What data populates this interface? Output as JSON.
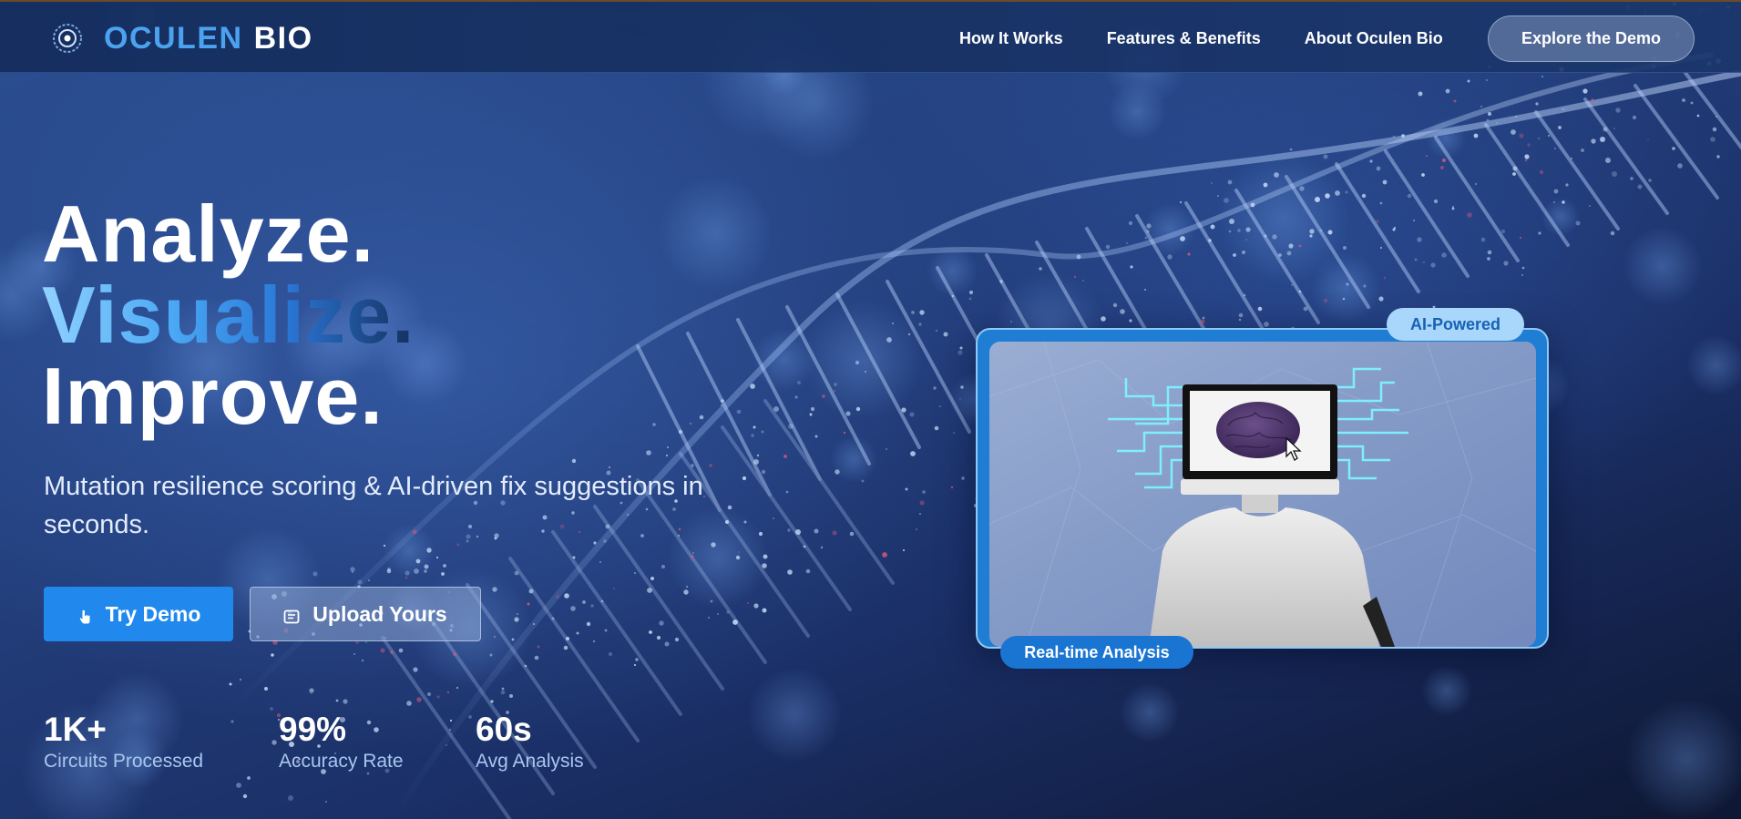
{
  "brand": {
    "name_part1": "OCULEN",
    "name_part2": "BIO"
  },
  "nav": {
    "links": [
      "How It Works",
      "Features & Benefits",
      "About Oculen Bio"
    ],
    "cta": "Explore the Demo"
  },
  "hero": {
    "headline": [
      "Analyze.",
      "Visualize.",
      "Improve."
    ],
    "subtitle": "Mutation resilience scoring & AI-driven fix suggestions in seconds.",
    "primary_button": "Try Demo",
    "secondary_button": "Upload Yours",
    "stats": [
      {
        "value": "1K+",
        "label": "Circuits Processed"
      },
      {
        "value": "99%",
        "label": "Accuracy Rate"
      },
      {
        "value": "60s",
        "label": "Avg Analysis"
      }
    ]
  },
  "visual_card": {
    "badge_top": "AI-Powered",
    "badge_bottom": "Real-time Analysis"
  },
  "colors": {
    "accent": "#2189ee",
    "brand_blue": "#4ba3f0",
    "background": "#1b2f5e"
  }
}
